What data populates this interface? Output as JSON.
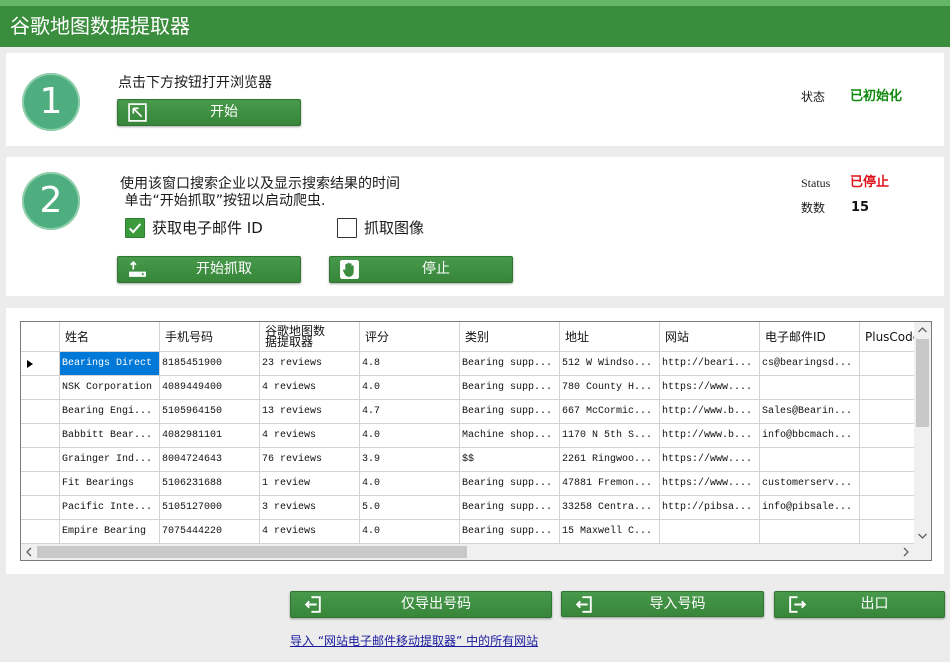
{
  "window": {
    "title": "谷歌地图数据提取器"
  },
  "step1": {
    "number": "1",
    "instruction": "点击下方按钮打开浏览器",
    "start_button": {
      "label": "开始",
      "icon": "open-window-icon"
    },
    "status_label": "状态",
    "status_value": "已初始化"
  },
  "step2": {
    "number": "2",
    "instruction_line1": "使用该窗口搜索企业以及显示搜索结果的时间",
    "instruction_line2": " 单击“开始抓取”按钮以启动爬虫.",
    "email_checkbox": {
      "label": "获取电子邮件 ID",
      "checked": true
    },
    "image_checkbox": {
      "label": "抓取图像",
      "checked": false
    },
    "scrape_button": {
      "label": "开始抓取",
      "icon": "scraper-icon"
    },
    "stop_button": {
      "label": "停止",
      "icon": "stop-hand-icon"
    },
    "status_label": "Status",
    "status_value": "已停止",
    "count_label": "数数",
    "count_value": "15"
  },
  "grid": {
    "columns": [
      "姓名",
      "手机号码",
      "谷歌地图数据提取器",
      "评分",
      "类别",
      "地址",
      "网站",
      "电子邮件ID",
      "PlusCode"
    ],
    "rows": [
      [
        "Bearings Direct",
        "8185451900",
        "23 reviews",
        "4.8",
        "Bearing supp...",
        "512 W Windso...",
        "http://beari...",
        "cs@bearingsd...",
        ""
      ],
      [
        "NSK Corporation",
        "4089449400",
        "4 reviews",
        "4.0",
        "Bearing supp...",
        "780 County H...",
        "https://www....",
        "",
        ""
      ],
      [
        "Bearing Engi...",
        "5105964150",
        "13 reviews",
        "4.7",
        "Bearing supp...",
        "667 McCormic...",
        "http://www.b...",
        "Sales@Bearin...",
        ""
      ],
      [
        "Babbitt Bear...",
        "4082981101",
        "4 reviews",
        "4.0",
        "Machine shop...",
        "1170 N 5th S...",
        "http://www.b...",
        "info@bbcmach...",
        ""
      ],
      [
        "Grainger Ind...",
        "8004724643",
        "76 reviews",
        "3.9",
        "$$",
        "2261 Ringwoo...",
        "https://www....",
        "",
        ""
      ],
      [
        "Fit Bearings",
        "5106231688",
        "1 review",
        "4.0",
        "Bearing supp...",
        "47881 Fremon...",
        "https://www....",
        "customerserv...",
        ""
      ],
      [
        "Pacific Inte...",
        "5105127000",
        "3 reviews",
        "5.0",
        "Bearing supp...",
        "33258 Centra...",
        "http://pibsa...",
        "info@pibsale...",
        ""
      ],
      [
        "Empire Bearing",
        "7075444220",
        "4 reviews",
        "4.0",
        "Bearing supp...",
        "15 Maxwell C...",
        "",
        "",
        ""
      ]
    ],
    "current_row": 0,
    "selected_cell": [
      0,
      0
    ]
  },
  "footer": {
    "export_numbers_button": {
      "label": "仅导出号码",
      "icon": "export-icon"
    },
    "import_numbers_button": {
      "label": "导入号码",
      "icon": "import-icon"
    },
    "exit_button": {
      "label": "出口",
      "icon": "exit-icon"
    },
    "import_link": "导入 “网站电子邮件移动提取器” 中的所有网站"
  },
  "colors": {
    "title_bar": "#3a8d3c",
    "step_circle": "#4fae7f",
    "button": "#3d8c40",
    "status_ok": "#0f8a0f",
    "status_stopped": "#e0131a",
    "selection": "#0078d7",
    "link": "#1a1aa0"
  }
}
